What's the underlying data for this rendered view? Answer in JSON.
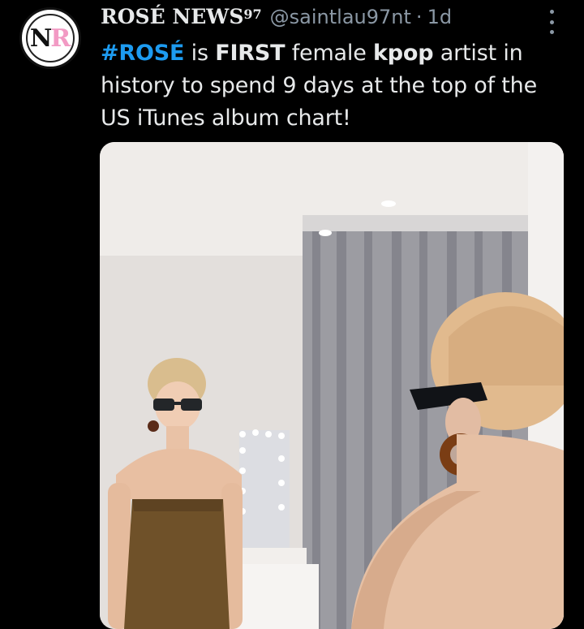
{
  "tweet": {
    "display_name": "ROSÉ NEWS",
    "display_name_sup": "97",
    "handle": "@saintlau97nt",
    "separator": "·",
    "timestamp": "1d",
    "avatar_letters": {
      "n": "N",
      "r": "R"
    },
    "text": {
      "hashtag": "#ROSÉ",
      "part1": " is ",
      "bold1": "FIRST",
      "part2": " female ",
      "bold2": "kpop",
      "part3": " artist in history to spend 9 days at the top of the US iTunes album chart!"
    },
    "more_icon": "more-vertical-icon"
  },
  "colors": {
    "background": "#000000",
    "text": "#e7e9ea",
    "muted": "#8b98a5",
    "link": "#1d9bf0",
    "avatar_accent": "#f29ac4"
  }
}
